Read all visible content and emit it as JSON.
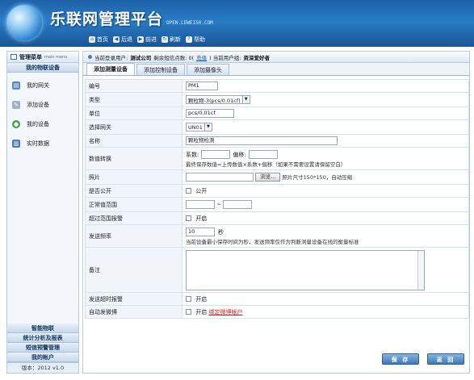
{
  "header": {
    "title": "乐联网管理平台",
    "site": "OPEN.LEWEI50.COM",
    "nav": [
      {
        "icon": "home-icon",
        "glyph": "⌂",
        "label": "首页"
      },
      {
        "icon": "back-icon",
        "glyph": "◀",
        "label": "后退"
      },
      {
        "icon": "forward-icon",
        "glyph": "▶",
        "label": "前进"
      },
      {
        "icon": "refresh-icon",
        "glyph": "↻",
        "label": "刷新"
      },
      {
        "icon": "help-icon",
        "glyph": "?",
        "label": "帮助"
      }
    ]
  },
  "sidebar": {
    "head_title": "管理菜单",
    "head_sub": "main menu",
    "group_top": "我的物联设备",
    "items": [
      {
        "label": "我的网关",
        "icon": "gateway-icon",
        "glyph": "▤"
      },
      {
        "label": "添加设备",
        "icon": "add-device-icon",
        "glyph": "✎"
      },
      {
        "label": "我的设备",
        "icon": "device-icon",
        "glyph": "●"
      },
      {
        "label": "实时数据",
        "icon": "data-icon",
        "glyph": "▥"
      }
    ],
    "groups_bottom": [
      "智能物联",
      "统计分析及报表",
      "短信预警管理",
      "我的帐户"
    ],
    "version": "版本：2012 v1.0"
  },
  "infobar": {
    "prefix": "当前登录用户:",
    "user": "测试公司",
    "sms_label": "剩余短信点数: 0(",
    "recharge": "充值",
    "group_label": ") 当前用户组:",
    "group": "资深爱好者"
  },
  "tabs": [
    "添加测量设备",
    "添加控制设备",
    "添加摄像头"
  ],
  "form": {
    "code_label": "编号",
    "code_value": "PM1",
    "type_label": "类型",
    "type_value": "颗粒物-3(pcs/0.01cf)",
    "unit_label": "单位",
    "unit_value": "pcs/0.01cf",
    "gateway_label": "选择网关",
    "gateway_value": "UN01",
    "name_label": "名称",
    "name_value": "颗粒物检测",
    "convert_label": "数值转换",
    "coef_label": "系数:",
    "offset_label": "偏移:",
    "convert_hint": "最终保存数值=上传数值×系数+偏移（如果不需要设置请保留空白）",
    "photo_label": "照片",
    "browse_label": "浏览...",
    "photo_hint": "照片尺寸150*150，自动压缩",
    "public_label": "是否公开",
    "public_check": "公开",
    "range_label": "正常值范围",
    "range_sep": "~",
    "alarm_label": "超过范围报警",
    "alarm_check": "开启",
    "freq_label": "发送频率",
    "freq_value": "10",
    "freq_unit": "秒",
    "freq_hint": "当前设备最小保存时间为秒，发送频率仅作为判断测量设备在线的衡量标准",
    "remark_label": "备注",
    "timeout_label": "发送超时报警",
    "timeout_check": "开启",
    "weibo_label": "自动发微博",
    "weibo_check": "开启",
    "weibo_link": "绑定微博帐户"
  },
  "actions": {
    "save": "保 存",
    "back": "返 回"
  }
}
